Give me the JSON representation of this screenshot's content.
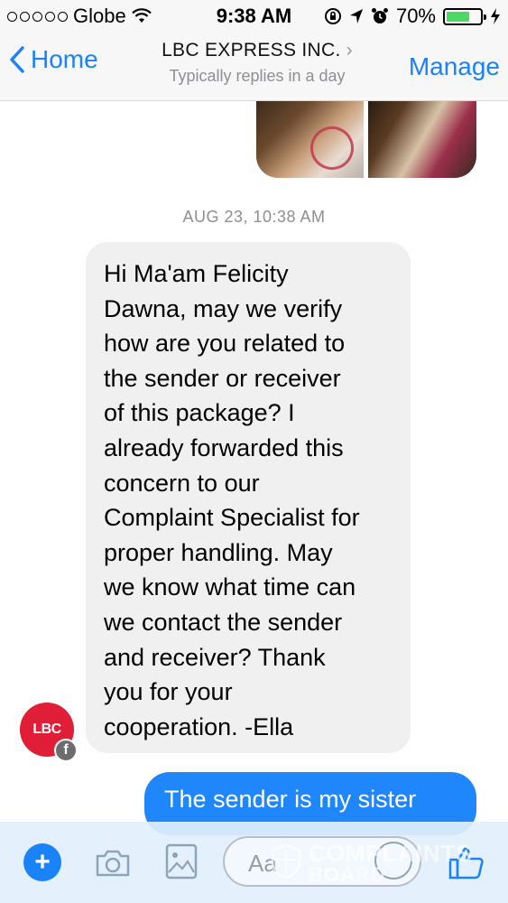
{
  "status_bar": {
    "carrier": "Globe",
    "time": "9:38 AM",
    "battery": "70%"
  },
  "nav": {
    "back_label": "Home",
    "title": "LBC EXPRESS INC.",
    "subtitle": "Typically replies in a day",
    "manage_label": "Manage"
  },
  "thread": {
    "timestamp": "AUG 23, 10:38 AM",
    "incoming": {
      "avatar_text": "LBC",
      "badge": "f",
      "lines": [
        "Hi Ma'am Felicity",
        "Dawna, may we verify",
        "how are you related to",
        "the sender or receiver",
        "of this package? I",
        "already forwarded this",
        "concern to our",
        "Complaint Specialist for",
        "proper handling. May",
        "we know what time can",
        "we contact the sender",
        "and receiver? Thank",
        "you for your",
        "cooperation. -Ella"
      ]
    },
    "outgoing": {
      "text": "The sender is my sister"
    }
  },
  "composer": {
    "plus": "+",
    "input_placeholder": "Aa"
  },
  "watermark": {
    "line1": "COMPLAINTS",
    "line2": "BOARD"
  },
  "colors": {
    "accent": "#1a82fb",
    "outgoing_bubble": "#1f86fb",
    "incoming_bubble": "#f1f0f0",
    "brand_red": "#e01e37",
    "battery_green": "#4cd964"
  },
  "icons": {
    "back": "chevron-left-icon",
    "title_chevron": "chevron-right-icon",
    "wifi": "wifi-icon",
    "lock": "rotation-lock-icon",
    "location": "location-arrow-icon",
    "alarm": "alarm-icon",
    "charging": "bolt-icon",
    "camera": "camera-icon",
    "gallery": "image-icon",
    "emoji": "smiley-icon",
    "like": "thumbs-up-icon"
  }
}
